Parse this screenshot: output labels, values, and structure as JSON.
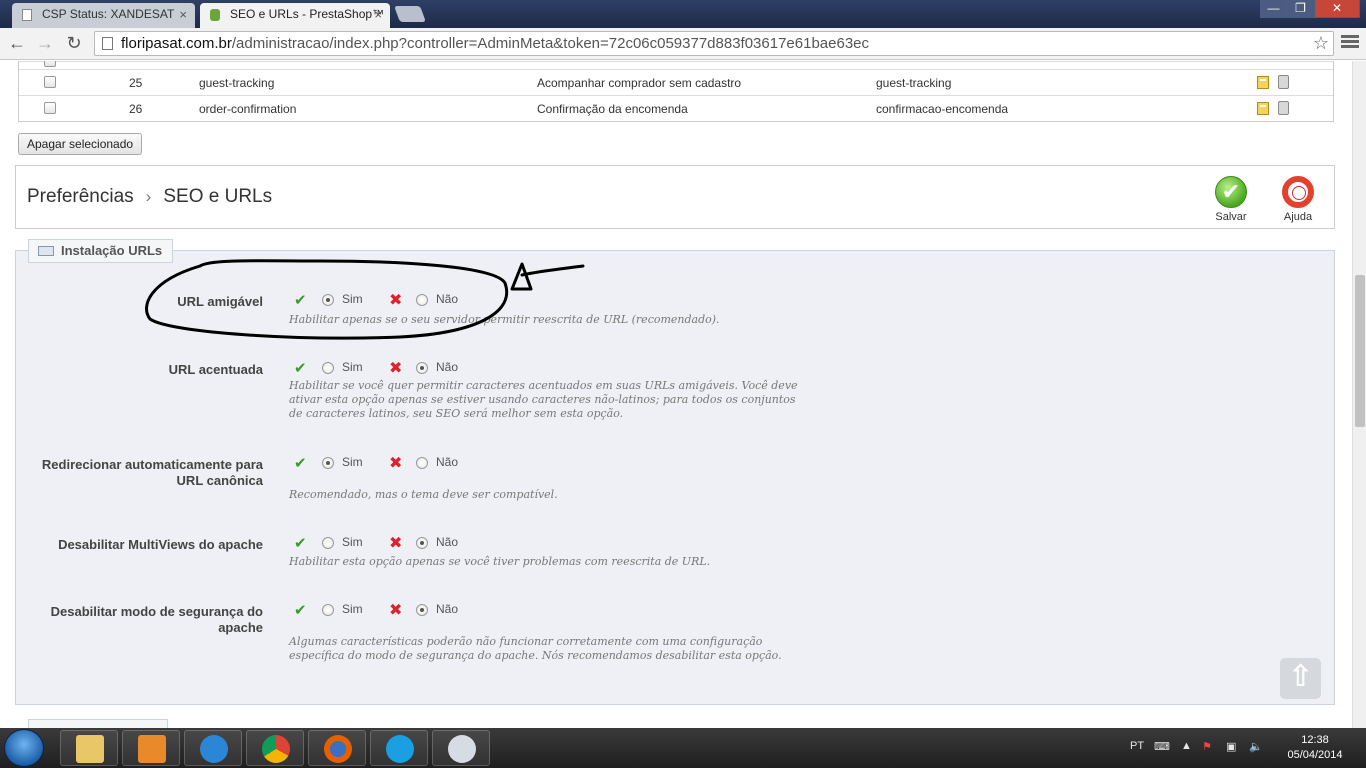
{
  "browser": {
    "tabs": [
      {
        "title": "CSP Status: XANDESAT",
        "close": "×"
      },
      {
        "title": "SEO e URLs - PrestaShop™",
        "close": "×"
      }
    ],
    "url_domain": "floripasat.com.br",
    "url_path": "/administracao/index.php?controller=AdminMeta&token=72c06c059377d883f03617e61bae63ec",
    "back_icon": "back-arrow-icon",
    "forward_icon": "forward-arrow-icon",
    "reload_icon": "reload-icon",
    "star_icon": "☆",
    "window": {
      "min": "—",
      "max": "❐",
      "close": "✕"
    }
  },
  "meta_table": {
    "rows": [
      {
        "id": "25",
        "page": "guest-tracking",
        "title": "Acompanhar comprador sem cadastro",
        "url": "guest-tracking"
      },
      {
        "id": "26",
        "page": "order-confirmation",
        "title": "Confirmação da encomenda",
        "url": "confirmacao-encomenda"
      }
    ]
  },
  "bulk": {
    "delete_label": "Apagar selecionado"
  },
  "header": {
    "breadcrumb_parent": "Preferências",
    "breadcrumb_sep": "›",
    "breadcrumb_current": "SEO e URLs",
    "save_label": "Salvar",
    "save_icon": "✔",
    "help_label": "Ajuda"
  },
  "url_setup": {
    "legend": "Instalação URLs",
    "yes_label": "Sim",
    "no_label": "Não",
    "yes_icon": "✔",
    "no_icon": "✖",
    "options": [
      {
        "label": "URL amigável",
        "selected": "yes",
        "hint": "Habilitar apenas se o seu servidor permitir reescrita de URL (recomendado)."
      },
      {
        "label": "URL acentuada",
        "selected": "no",
        "hint": "Habilitar se você quer permitir caracteres acentuados em suas URLs amigáveis. Você deve ativar esta opção apenas se estiver usando caracteres não-latinos; para todos os conjuntos de caracteres latinos, seu SEO será melhor sem esta opção."
      },
      {
        "label": "Redirecionar automaticamente para URL canônica",
        "selected": "yes",
        "hint": "Recomendado, mas o tema deve ser compatível."
      },
      {
        "label": "Desabilitar MultiViews do apache",
        "selected": "no",
        "hint": "Habilitar esta opção apenas se você tiver problemas com reescrita de URL."
      },
      {
        "label": "Desabilitar modo de segurança do apache",
        "selected": "no",
        "hint": "Algumas características poderão não funcionar corretamente com uma configuração específica do modo de segurança do apache. Nós recomendamos desabilitar esta opção."
      }
    ]
  },
  "taskbar": {
    "apps": [
      "file-explorer-icon",
      "media-player-icon",
      "internet-explorer-icon",
      "chrome-icon",
      "firefox-icon",
      "skype-icon",
      "paint-icon"
    ],
    "lang": "PT",
    "time": "12:38",
    "date": "05/04/2014"
  }
}
